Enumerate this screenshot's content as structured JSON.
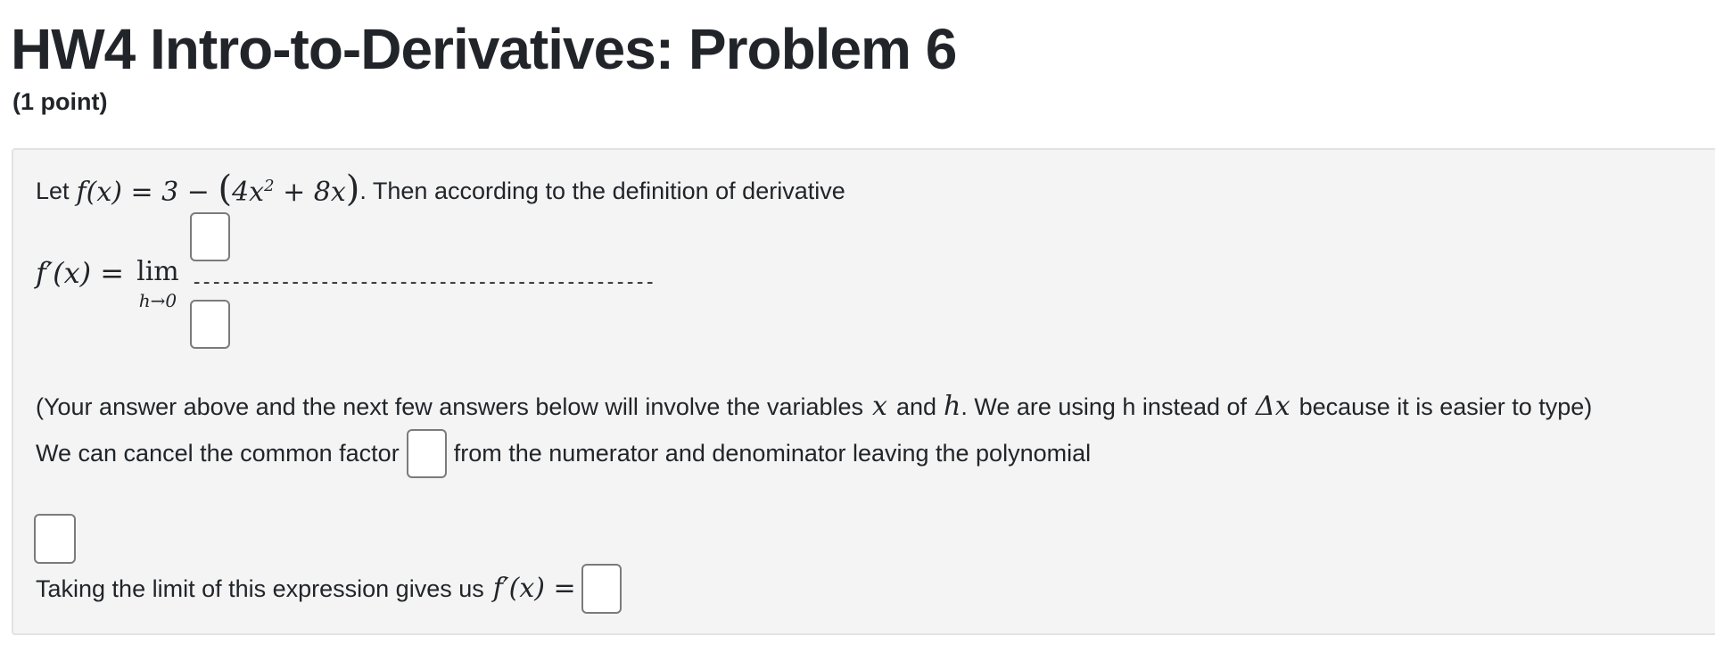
{
  "header": {
    "title": "HW4 Intro-to-Derivatives: Problem 6",
    "points": "(1 point)"
  },
  "problem": {
    "intro_prefix": "Let",
    "function_def": {
      "lhs": "f(x) = 3 − ",
      "open_paren": "(",
      "inner": "4x",
      "exponent": "2",
      "inner_rest": " + 8x",
      "close_paren": ")"
    },
    "intro_suffix": ". Then according to the definition of derivative",
    "limit": {
      "lhs": "f′(x) =",
      "operator": "lim",
      "subscript": "h→0",
      "fraction_bar": "-----------------------------------------------"
    },
    "note_part1": "(Your answer above and the next few answers below will involve the variables",
    "note_var_x": "x",
    "note_and": "and",
    "note_var_h": "h",
    "note_part2": ". We are using h instead of",
    "note_delta": "Δx",
    "note_part3": "because it is easier to type)",
    "cancel_prefix": "We can cancel the common factor",
    "cancel_suffix": "from the numerator and denominator leaving the polynomial",
    "limit_prefix": "Taking the limit of this expression gives us",
    "limit_expr": "f′(x) ="
  }
}
